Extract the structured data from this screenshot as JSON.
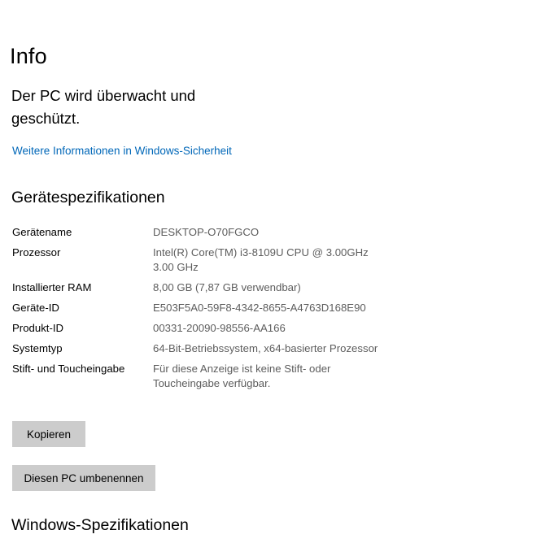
{
  "page": {
    "title": "Info",
    "protection_status": "Der PC wird überwacht und geschützt.",
    "security_link": "Weitere Informationen in Windows-Sicherheit"
  },
  "device_specs": {
    "heading": "Gerätespezifikationen",
    "rows": [
      {
        "label": "Gerätename",
        "value": "DESKTOP-O70FGCO"
      },
      {
        "label": "Prozessor",
        "value": "Intel(R) Core(TM) i3-8109U CPU @ 3.00GHz 3.00 GHz"
      },
      {
        "label": "Installierter RAM",
        "value": "8,00 GB (7,87 GB verwendbar)"
      },
      {
        "label": "Geräte-ID",
        "value": "E503F5A0-59F8-4342-8655-A4763D168E90"
      },
      {
        "label": "Produkt-ID",
        "value": "00331-20090-98556-AA166"
      },
      {
        "label": "Systemtyp",
        "value": "64-Bit-Betriebssystem, x64-basierter Prozessor"
      },
      {
        "label": "Stift- und Toucheingabe",
        "value": "Für diese Anzeige ist keine Stift- oder Toucheingabe verfügbar."
      }
    ],
    "copy_button": "Kopieren",
    "rename_button": "Diesen PC umbenennen"
  },
  "windows_specs": {
    "heading": "Windows-Spezifikationen"
  }
}
